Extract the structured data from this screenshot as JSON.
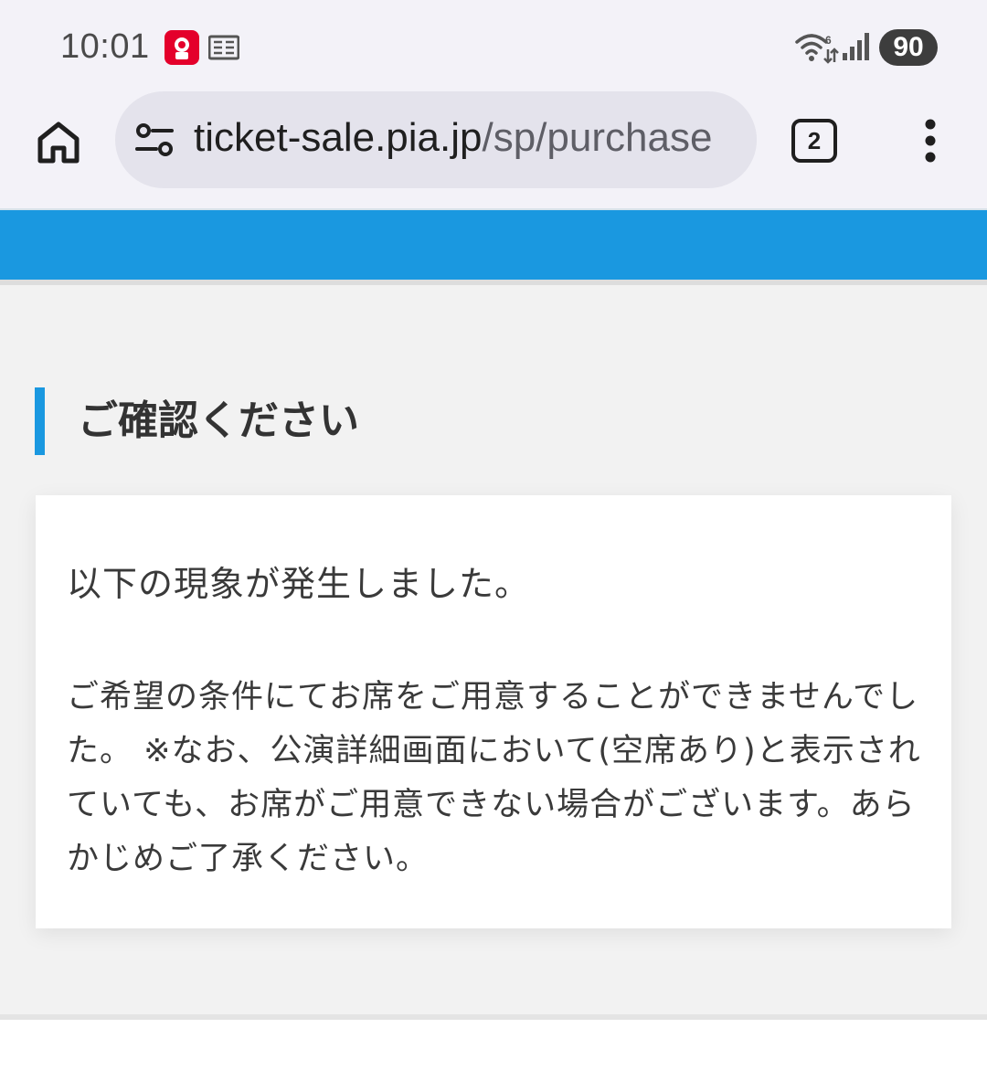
{
  "status_bar": {
    "time": "10:01",
    "battery": "90",
    "icons": [
      "kfc-app-icon",
      "news-icon",
      "wifi-icon",
      "signal-icon"
    ]
  },
  "browser": {
    "url_host": "ticket-sale.pia.jp",
    "url_path": "/sp/purchase",
    "tab_count": "2",
    "icons": [
      "home-icon",
      "site-info-icon",
      "more-options-icon"
    ]
  },
  "page": {
    "header_color": "#1a98e0",
    "heading": "ご確認ください",
    "message_lead": "以下の現象が発生しました。",
    "message_detail": "ご希望の条件にてお席をご用意することができませんでした。 ※なお、公演詳細画面において(空席あり)と表示されていても、お席がご用意できない場合がございます。あらかじめご了承ください。"
  }
}
